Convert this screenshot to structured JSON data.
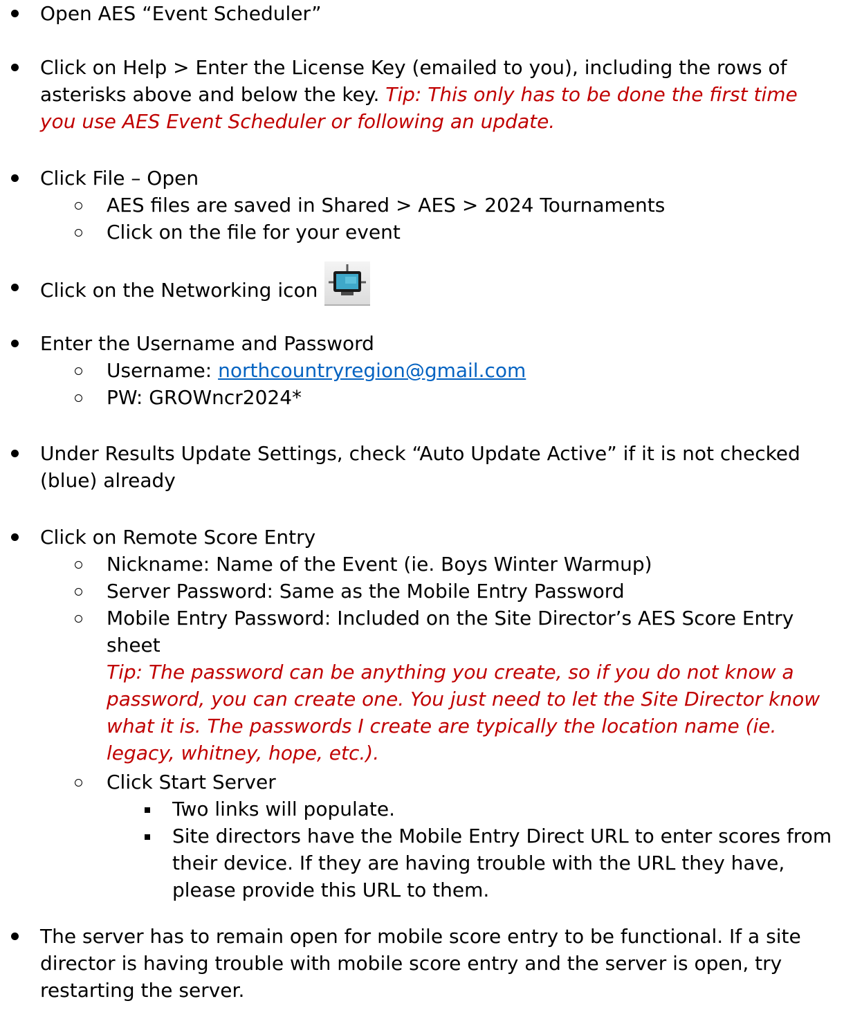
{
  "steps": {
    "s1": {
      "text": "Open AES “Event Scheduler”"
    },
    "s2": {
      "text": "Click on Help > Enter the License Key (emailed to you), including the rows of asterisks above and below the key.  ",
      "tip": "Tip: This only has to be done the first time you use AES Event Scheduler or following an update."
    },
    "s3": {
      "text": "Click File – Open",
      "sub": [
        "AES files are saved in Shared > AES > 2024 Tournaments",
        "Click on the file for your event"
      ]
    },
    "s4": {
      "text": "Click on the Networking icon",
      "icon": "networking-icon"
    },
    "s5": {
      "text": "Enter the Username and Password",
      "username_label": "Username: ",
      "username_link": "northcountryregion@gmail.com",
      "password": "PW: GROWncr2024*"
    },
    "s6": {
      "text": "Under Results Update Settings, check “Auto Update Active” if it is not checked (blue) already"
    },
    "s7": {
      "text": "Click on Remote Score Entry",
      "sub": [
        "Nickname: Name of the Event (ie. Boys Winter Warmup)",
        "Server Password:  Same as the Mobile Entry Password",
        "Mobile Entry Password: Included on the Site Director’s AES Score Entry sheet",
        "Click Start Server"
      ],
      "tip": "Tip: The password can be anything you create, so if you do not know a password, you can create one.  You just need to let the Site Director know what it is.  The passwords I create are typically the location name (ie. legacy, whitney, hope, etc.).",
      "subsub": [
        "Two links will populate.",
        "Site directors have the Mobile Entry Direct URL to enter scores from their device.  If they are having trouble with the URL they have, please provide this URL to them."
      ]
    },
    "s8": {
      "text": "The server has to remain open for mobile score entry to be functional.  If a site director is having trouble with mobile score entry and the server is open, try restarting the server."
    }
  }
}
